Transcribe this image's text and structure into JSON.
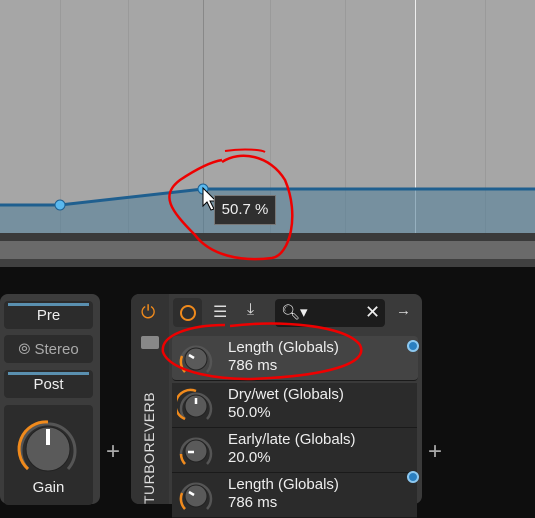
{
  "automation": {
    "tooltip": "50.7 %",
    "line_color": "#1f5f8f",
    "point_color": "#5ab8ee"
  },
  "left_panel": {
    "pre": "Pre",
    "stereo": "Stereo",
    "post": "Post",
    "gain": "Gain"
  },
  "device": {
    "name": "TURBOREVERB",
    "search_placeholder": "",
    "params": [
      {
        "name": "Length (Globals)",
        "value": "786 ms",
        "knob": 0.3
      },
      {
        "name": "Dry/wet (Globals)",
        "value": "50.0%",
        "knob": 0.5
      },
      {
        "name": "Early/late (Globals)",
        "value": "20.0%",
        "knob": 0.2
      },
      {
        "name": "Length (Globals)",
        "value": "786 ms",
        "knob": 0.3
      }
    ]
  },
  "accent": "#f08a1c"
}
